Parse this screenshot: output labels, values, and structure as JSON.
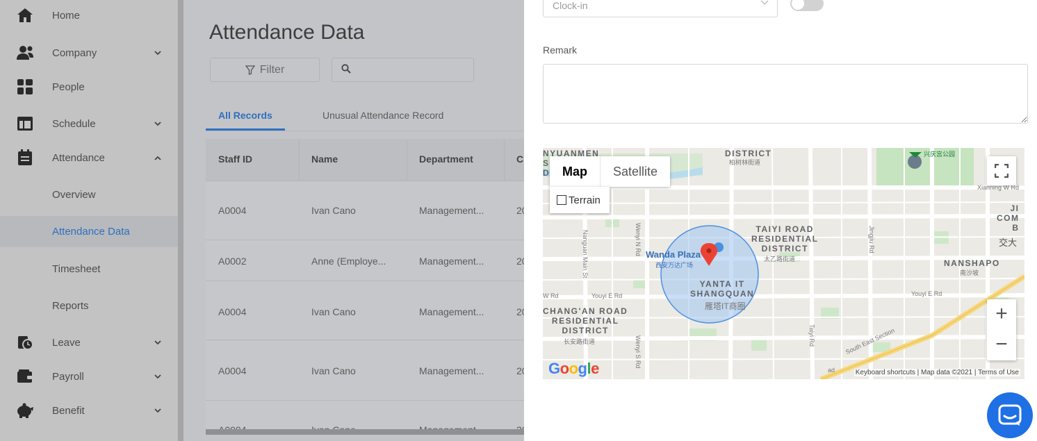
{
  "sidebar": {
    "items": [
      {
        "label": "Home",
        "icon": "home-icon",
        "chevron": ""
      },
      {
        "label": "Company",
        "icon": "company-icon",
        "chevron": "⌄"
      },
      {
        "label": "People",
        "icon": "people-icon",
        "chevron": ""
      },
      {
        "label": "Schedule",
        "icon": "schedule-icon",
        "chevron": "⌄"
      },
      {
        "label": "Attendance",
        "icon": "attendance-icon",
        "chevron": "⌃"
      },
      {
        "label": "Overview"
      },
      {
        "label": "Attendance Data"
      },
      {
        "label": "Timesheet"
      },
      {
        "label": "Reports"
      },
      {
        "label": "Leave",
        "icon": "leave-icon",
        "chevron": "⌄"
      },
      {
        "label": "Payroll",
        "icon": "payroll-icon",
        "chevron": "⌄"
      },
      {
        "label": "Benefit",
        "icon": "benefit-icon",
        "chevron": "⌄"
      }
    ]
  },
  "main": {
    "title": "Attendance Data",
    "filter_label": "Filter",
    "search_placeholder": "",
    "tabs": [
      {
        "label": "All Records",
        "active": true
      },
      {
        "label": "Unusual Attendance Record",
        "active": false
      }
    ],
    "table": {
      "headers": [
        "Staff ID",
        "Name",
        "Department",
        "Cl"
      ],
      "rows": [
        [
          "A0004",
          "Ivan Cano",
          "Management...",
          "20"
        ],
        [
          "A0002",
          "Anne (Employe...",
          "Management...",
          "20"
        ],
        [
          "A0004",
          "Ivan Cano",
          "Management...",
          "20"
        ],
        [
          "A0004",
          "Ivan Cano",
          "Management...",
          "20"
        ],
        [
          "A0004",
          "Ivan Cano",
          "Management...",
          "20"
        ]
      ]
    }
  },
  "drawer": {
    "type_select_value": "Clock-in",
    "remark_label": "Remark",
    "remark_value": "",
    "map": {
      "type_map": "Map",
      "type_satellite": "Satellite",
      "terrain_label": "Terrain",
      "zoom_in": "+",
      "zoom_out": "−",
      "labels": {
        "nyuanmen": "NYUANMEN",
        "district_top": "DISTRICT",
        "district_top_cn": "柏树林街道",
        "taiyi": "TAIYI ROAD\nRESIDENTIAL\nDISTRICT",
        "taiyi_cn": "太乙路街道",
        "nanshapo": "NANSHAPO",
        "nanshapo_cn": "南沙坡",
        "yanta": "YANTA IT\nSHANGQUAN",
        "yanta_cn": "雁塔IT商圈",
        "changan": "CHANG'AN ROAD\nRESIDENTIAL\nDISTRICT",
        "changan_cn": "长安路街道",
        "wanda": "Wanda Plaza",
        "wanda_cn": "西安万达广场",
        "xingqing": "兴庆宫公园",
        "xianning": "Xianning W Rd",
        "youyi": "Youyi E Rd",
        "youyi2": "Youyi E Rd",
        "wrd": "W Rd",
        "wenyi_n": "Wenyi N Rd",
        "wenyi_s": "Wenyi S Rd",
        "nanguan": "Nanguan Main St",
        "jingjiu": "Jingjiu Rd",
        "taiyi_rd": "Taiyi Rd",
        "south_east": "South East Section",
        "ji_com": "JI\nCOM\nB",
        "jiaoda": "交大",
        "s_di": "S\nDI",
        "ad": "ad"
      },
      "google": "Google",
      "attribution": "Keyboard shortcuts  |  Map data ©2021  |  Terms of Use"
    }
  },
  "colors": {
    "accent": "#2f6fbf",
    "chat": "#1f6fe5",
    "marker": "#ea4335",
    "circle": "#4a90e2"
  }
}
